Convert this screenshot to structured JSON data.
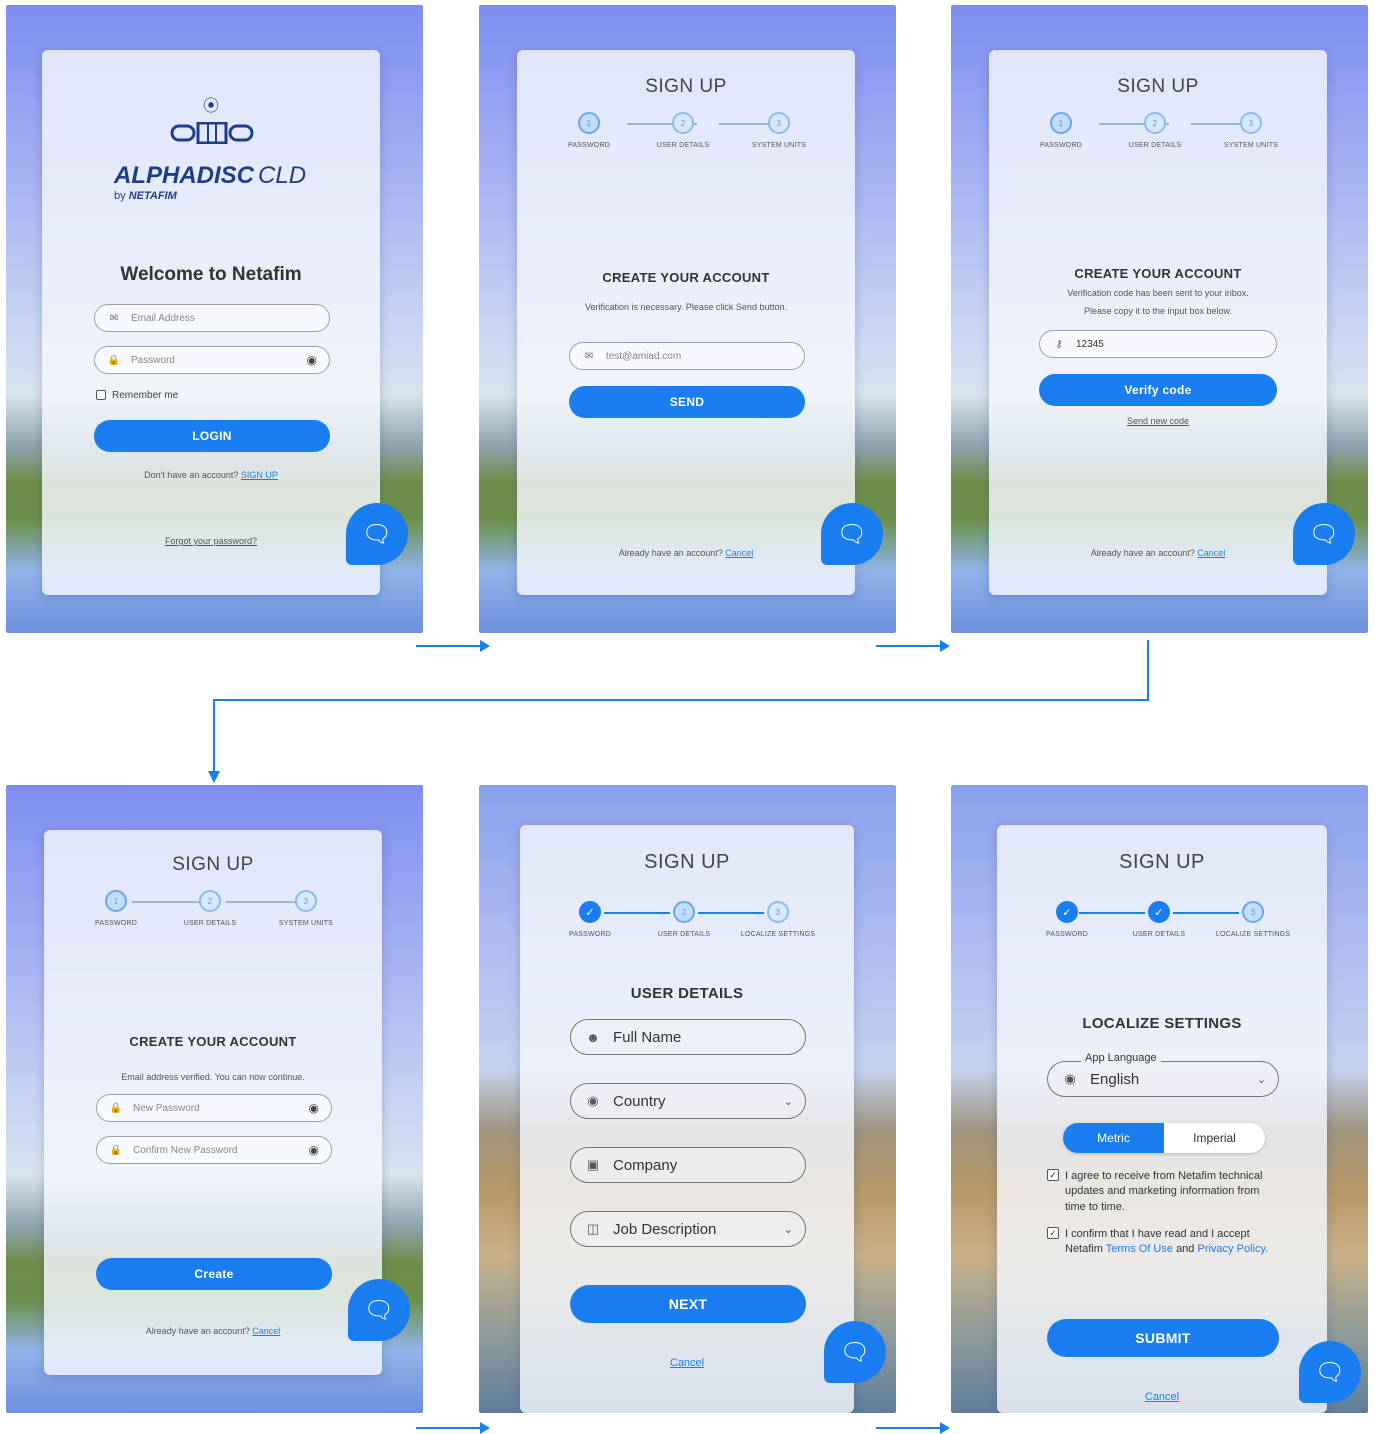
{
  "screen1": {
    "logo_brand": "ALPHADISC",
    "logo_suffix": "CLD",
    "logo_by": "by",
    "logo_company": "NETAFIM",
    "welcome": "Welcome to Netafim",
    "email_placeholder": "Email Address",
    "password_placeholder": "Password",
    "remember": "Remember me",
    "login": "LOGIN",
    "no_account": "Don't have an account?",
    "signup_link": "SIGN UP",
    "forgot": "Forgot your password?"
  },
  "signup": {
    "title": "SIGN UP",
    "steps_a": [
      "PASSWORD",
      "USER DETAILS",
      "SYSTEM UNITS"
    ],
    "steps_b": [
      "PASSWORD",
      "USER DETAILS",
      "LOCALIZE SETTINGS"
    ],
    "step_nums": [
      "1",
      "2",
      "3"
    ],
    "already": "Already have an account?",
    "cancel": "Cancel"
  },
  "screen2": {
    "heading": "CREATE YOUR ACCOUNT",
    "info": "Verification is necessary. Please click Send button.",
    "email_value": "test@amiad.com",
    "send": "SEND"
  },
  "screen3": {
    "heading": "CREATE YOUR ACCOUNT",
    "info1": "Verification code has been sent to your inbox.",
    "info2": "Please copy it to the input box below.",
    "code_value": "12345",
    "verify": "Verify code",
    "send_new": "Send new code"
  },
  "screen4": {
    "heading": "CREATE YOUR ACCOUNT",
    "info": "Email address verified. You can now continue.",
    "new_password": "New Password",
    "confirm_password": "Confirm New Password",
    "create": "Create"
  },
  "screen5": {
    "heading": "USER DETAILS",
    "full_name": "Full Name",
    "country": "Country",
    "company": "Company",
    "job": "Job Description",
    "next": "NEXT"
  },
  "screen6": {
    "heading": "LOCALIZE SETTINGS",
    "lang_label": "App Language",
    "lang_value": "English",
    "metric": "Metric",
    "imperial": "Imperial",
    "agree1": "I agree to receive from Netafim technical updates and marketing information from time to time.",
    "agree2_pre": "I confirm that I have read and I accept Netafim",
    "terms": "Terms Of Use",
    "and": "and",
    "privacy": "Privacy Policy.",
    "submit": "SUBMIT"
  },
  "colors": {
    "accent": "#1a7ef0"
  },
  "icons": [
    "wifi-icon",
    "valve-icon",
    "mail-icon",
    "lock-icon",
    "eye-icon",
    "chat-icon",
    "user-icon",
    "globe-icon",
    "building-icon",
    "briefcase-icon",
    "key-icon",
    "chevron-down-icon",
    "check-icon"
  ]
}
